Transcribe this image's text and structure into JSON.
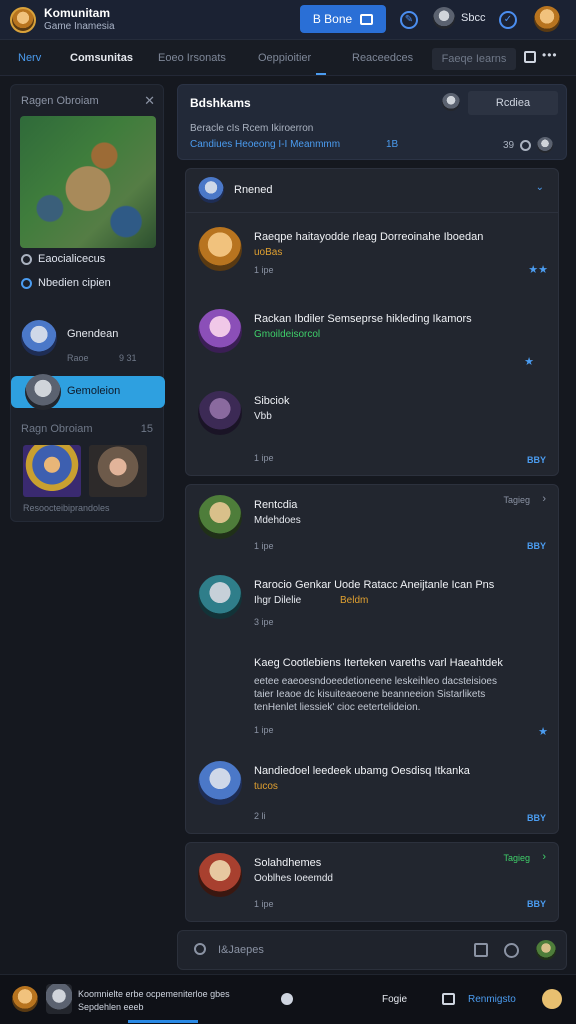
{
  "app": {
    "title": "Komunitam",
    "subtitle": "Game Inamesia"
  },
  "topbar": {
    "primary_button_label": "B Bone",
    "user_name": "Sbcc"
  },
  "tabs": [
    {
      "label": "Nerv"
    },
    {
      "label": "Comsunitas"
    },
    {
      "label": "Eoeo Irsonats"
    },
    {
      "label": "Oeppioitier"
    },
    {
      "label": "Reaceedces"
    },
    {
      "label": "Faeqe Iearns"
    }
  ],
  "sidebar": {
    "header": "Ragen Obroiam",
    "options": [
      {
        "label": "Eaocialicecus"
      },
      {
        "label": "Nbedien cipien"
      }
    ],
    "contacts": [
      {
        "name": "Gnendean",
        "sub": "Raoe",
        "sub_right": "9 31"
      },
      {
        "name": "Gemoleion",
        "sub": "",
        "sub_right": ""
      }
    ],
    "section": "Ragn Obroiam",
    "section_right": "15",
    "footer": "Resoocteibiprandoles"
  },
  "main_header": {
    "title": "Bdshkams",
    "button_label": "Rcdiea",
    "line1": "Beracle cIs  Rcem Ikiroerron",
    "line2": "Candiues  Heoeong  I-I  Meanmmm",
    "line2_right": "1B",
    "count": "39"
  },
  "threads": [
    {
      "header_name": "Rnened",
      "messages": [
        {
          "title": "Raeqpe haitayodde rleag Dorreoinahe Iboedan",
          "subtitle": "uoBas",
          "meta": "1 ipe"
        },
        {
          "title": "Rackan Ibdiler Semseprse hikleding Ikamors",
          "subtitle": "Gmoildeisorcol",
          "meta": ""
        },
        {
          "title": "Sibciok",
          "subtitle": "Vbb",
          "meta": "1 ipe",
          "tag": "BBY"
        }
      ]
    },
    {
      "header_name": "Rentcdia",
      "header_right": "Tagieg",
      "messages": [
        {
          "title": "Rentcdia",
          "subtitle": "Mdehdoes",
          "meta": "1 ipe",
          "tag": "BBY"
        },
        {
          "title": "Rarocio Genkar Uode Ratacc Aneijtanle  Ican Pns",
          "subtitle": "Ihgr Dilelie",
          "sub_extra": "Beldm",
          "meta": "3 ipe"
        },
        {
          "title": "Kaeg Cootlebiens Iterteken vareths varl Haeahtdek",
          "body": [
            "eetee eaeoesndoeedetioneene leskeihleo dacsteisioes",
            "taier Ieaoe dc kisuiteaeoene beanneeion Sistarlikets",
            "tenHenlet liessiek' cioc eetertelideion."
          ],
          "meta": "1 ipe"
        },
        {
          "title": "Nandiedoel leedeek ubamg Oesdisq Itkanka",
          "subtitle": "tucos",
          "meta": "2 li",
          "tag": "BBY"
        }
      ]
    },
    {
      "header_name": "Solahdhemes",
      "header_right": "Tagieg",
      "messages": [
        {
          "title": "Solahdhemes",
          "subtitle": "Ooblhes Ioeemdd",
          "meta": "1 ipe",
          "tag": "BBY"
        }
      ]
    }
  ],
  "composer": {
    "placeholder": "I&Jaepes"
  },
  "bottombar": {
    "line1": "Koomnielte erbe ocpemeniterloe gbes",
    "line2": "Sepdehlen eeeb",
    "item1": "Fogie",
    "item2": "Renmigsto"
  },
  "colors": {
    "accent": "#4b9cf0",
    "primary_button": "#2a6fd6",
    "active_contact": "#2ea0e0",
    "gold_text": "#e0a030",
    "green_text": "#3fcf6a"
  }
}
